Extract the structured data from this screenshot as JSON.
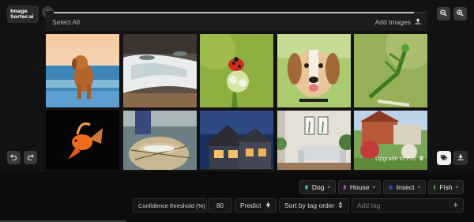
{
  "app": {
    "logo_line1": "Image",
    "logo_line2": "Sorter.ai"
  },
  "toolbar": {
    "select_all": "Select All",
    "add_images": "Add Images",
    "progress": 0.97
  },
  "grid": {
    "images": [
      {
        "subject": "dog on beach"
      },
      {
        "subject": "fish in stream"
      },
      {
        "subject": "ladybug on flower"
      },
      {
        "subject": "beagle portrait"
      },
      {
        "subject": "praying mantis"
      },
      {
        "subject": "goldfish"
      },
      {
        "subject": "fish in net"
      },
      {
        "subject": "house at dusk"
      },
      {
        "subject": "living room interior"
      },
      {
        "subject": "house with garden"
      }
    ]
  },
  "actions": {
    "upgrade_label": "Upgrade to Pro"
  },
  "tags": [
    {
      "label": "Dog",
      "color": "#3aa6a6"
    },
    {
      "label": "House",
      "color": "#c23dc2"
    },
    {
      "label": "Insect",
      "color": "#2f3f9c"
    },
    {
      "label": "Fish",
      "color": "#5aa33c"
    }
  ],
  "controls": {
    "confidence_label": "Confidence threshold (%)",
    "confidence_value": "80",
    "predict_label": "Predict",
    "sort_label": "Sort by tag order",
    "add_tag_placeholder": "Add tag"
  }
}
